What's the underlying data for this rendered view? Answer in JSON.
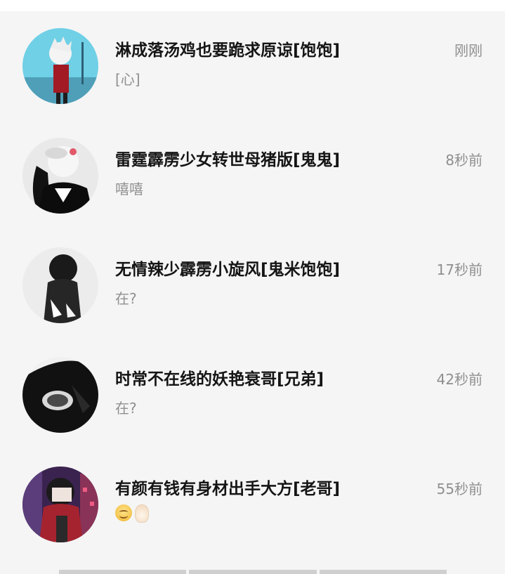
{
  "chats": [
    {
      "name": "淋成落汤鸡也要跪求原谅[饱饱]",
      "preview": "[心]",
      "time": "刚刚",
      "avatar_icon": "anime-boy-avatar-icon"
    },
    {
      "name": "雷霆霹雳少女转世母猪版[鬼鬼]",
      "preview": "嘻嘻",
      "time": "8秒前",
      "avatar_icon": "anime-girl-masked-avatar-icon"
    },
    {
      "name": "无情辣少霹雳小旋风[鬼米饱饱]",
      "preview": "在?",
      "time": "17秒前",
      "avatar_icon": "silhouette-avatar-icon"
    },
    {
      "name": "时常不在线的妖艳衰哥[兄弟]",
      "preview": "在?",
      "time": "42秒前",
      "avatar_icon": "dark-silhouette-avatar-icon"
    },
    {
      "name": "有颜有钱有身材出手大方[老哥]",
      "preview_emojis": [
        "smile-emoji-icon",
        "ok-hand-emoji-icon"
      ],
      "time": "55秒前",
      "avatar_icon": "anime-boy-city-avatar-icon"
    }
  ]
}
